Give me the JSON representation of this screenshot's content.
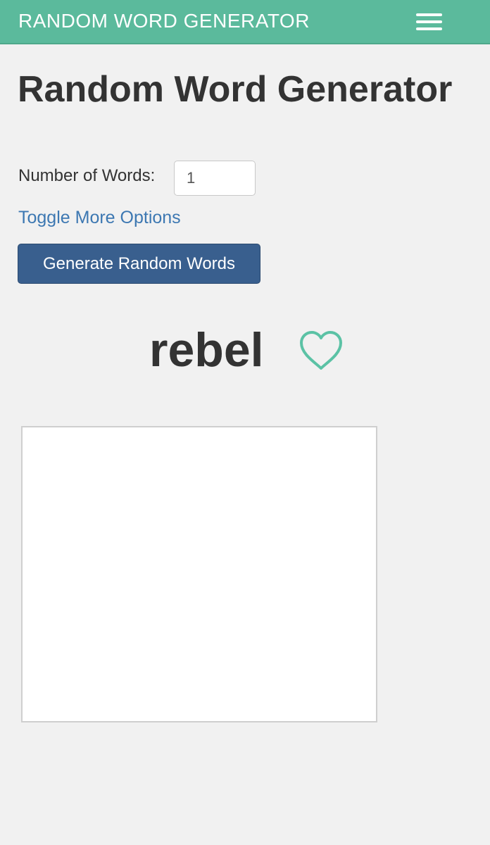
{
  "navbar": {
    "brand": "RANDOM WORD GENERATOR",
    "menu_icon": "hamburger-menu-icon",
    "bg_color": "#5bba9c"
  },
  "main": {
    "title": "Random Word Generator",
    "count_label": "Number of Words:",
    "count_value": "1",
    "toggle_link": "Toggle More Options",
    "generate_button": "Generate Random Words",
    "button_color": "#395f8e",
    "link_color": "#3d78b2"
  },
  "result": {
    "word": "rebel",
    "favorite_icon": "heart-outline-icon",
    "icon_color": "#5bc2a5"
  }
}
